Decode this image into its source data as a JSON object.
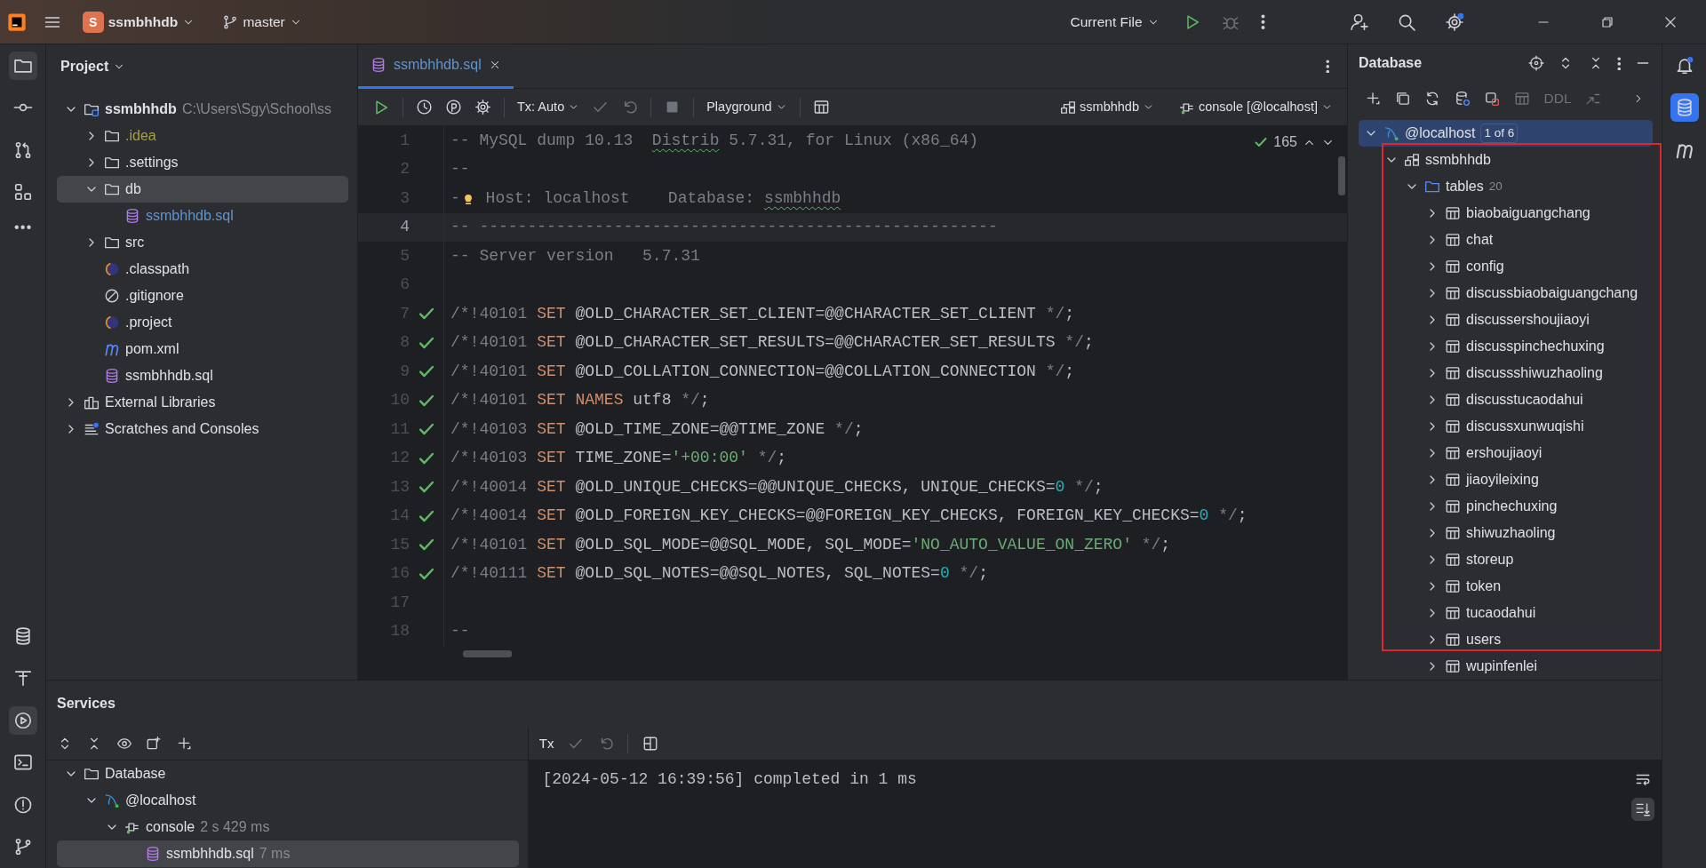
{
  "title_bar": {
    "project_badge": "S",
    "project": "ssmbhhdb",
    "branch": "master",
    "run_config": "Current File"
  },
  "left_toolbar": {
    "top": [
      {
        "kind": "folder",
        "selected": true
      },
      {
        "kind": "commit",
        "selected": false
      },
      {
        "kind": "pull_requests",
        "selected": false
      },
      {
        "kind": "structure",
        "selected": false
      },
      {
        "kind": "more",
        "selected": false
      }
    ],
    "bottom": [
      {
        "kind": "database",
        "selected": false
      },
      {
        "kind": "build",
        "selected": false
      },
      {
        "kind": "services",
        "selected": true
      },
      {
        "kind": "terminal",
        "selected": false
      },
      {
        "kind": "problems",
        "selected": false
      },
      {
        "kind": "git",
        "selected": false
      }
    ]
  },
  "right_toolbar": [
    {
      "kind": "notifications",
      "selected": false
    },
    {
      "kind": "database",
      "selected": true
    },
    {
      "kind": "maven",
      "selected": false
    }
  ],
  "project_panel": {
    "title": "Project",
    "tree": [
      {
        "label": "ssmbhhdb",
        "detail": "C:\\Users\\Sgy\\School\\ss",
        "kind": "module",
        "expanded": true,
        "selected": false,
        "children": [
          {
            "label": ".idea",
            "kind": "folder",
            "expanded": false,
            "selected": false,
            "color": "#a8a23a"
          },
          {
            "label": ".settings",
            "kind": "folder",
            "expanded": false,
            "selected": false
          },
          {
            "label": "db",
            "kind": "folder",
            "expanded": true,
            "selected": true,
            "children": [
              {
                "label": "ssmbhhdb.sql",
                "kind": "sql",
                "selected": false,
                "color": "#5e95d0"
              }
            ]
          },
          {
            "label": "src",
            "kind": "folder",
            "expanded": false,
            "selected": false
          },
          {
            "label": ".classpath",
            "kind": "eclipse",
            "selected": false
          },
          {
            "label": ".gitignore",
            "kind": "ignore",
            "selected": false
          },
          {
            "label": ".project",
            "kind": "eclipse",
            "selected": false
          },
          {
            "label": "pom.xml",
            "kind": "maven",
            "selected": false
          },
          {
            "label": "ssmbhhdb.sql",
            "kind": "sql",
            "selected": false
          }
        ]
      },
      {
        "label": "External Libraries",
        "kind": "libraries",
        "expanded": false,
        "selected": false
      },
      {
        "label": "Scratches and Consoles",
        "kind": "scratches",
        "expanded": false,
        "selected": false
      }
    ]
  },
  "editor": {
    "tab": {
      "label": "ssmbhhdb.sql",
      "selected": true
    },
    "toolbar": {
      "tx_mode": "Tx: Auto",
      "mode": "Playground",
      "schema": "ssmbhhdb",
      "session": "console [@localhost]"
    },
    "inspection_count": "165",
    "lines": [
      {
        "number": "1",
        "checked": false,
        "current": false,
        "tokens": [
          {
            "kind": "comment",
            "text": "-- MySQL dump 10.13  "
          },
          {
            "kind": "typo",
            "text": "Distrib"
          },
          {
            "kind": "comment",
            "text": " 5.7.31, for Linux (x86_64)"
          }
        ]
      },
      {
        "number": "2",
        "checked": false,
        "current": false,
        "tokens": [
          {
            "kind": "comment",
            "text": "--"
          }
        ]
      },
      {
        "number": "3",
        "checked": false,
        "current": false,
        "tokens": [
          {
            "kind": "comment",
            "text": "-"
          },
          {
            "kind": "bulb"
          },
          {
            "kind": "comment",
            "text": " Host: localhost    Database: "
          },
          {
            "kind": "typo",
            "text": "ssmbhhdb"
          }
        ]
      },
      {
        "number": "4",
        "checked": false,
        "current": true,
        "tokens": [
          {
            "kind": "comment",
            "text": "-- ------------------------------------------------------"
          }
        ]
      },
      {
        "number": "5",
        "checked": false,
        "current": false,
        "tokens": [
          {
            "kind": "comment",
            "text": "-- Server version   5.7.31"
          }
        ]
      },
      {
        "number": "6",
        "checked": false,
        "current": false
      },
      {
        "number": "7",
        "checked": true,
        "current": false,
        "tokens": [
          {
            "kind": "comment",
            "text": "/*!40101 "
          },
          {
            "kind": "keyword",
            "text": "SET"
          },
          {
            "kind": "plain",
            "text": " @OLD_CHARACTER_SET_CLIENT=@@CHARACTER_SET_CLIENT "
          },
          {
            "kind": "comment",
            "text": "*/"
          },
          {
            "kind": "plain",
            "text": ";"
          }
        ]
      },
      {
        "number": "8",
        "checked": true,
        "current": false,
        "tokens": [
          {
            "kind": "comment",
            "text": "/*!40101 "
          },
          {
            "kind": "keyword",
            "text": "SET"
          },
          {
            "kind": "plain",
            "text": " @OLD_CHARACTER_SET_RESULTS=@@CHARACTER_SET_RESULTS "
          },
          {
            "kind": "comment",
            "text": "*/"
          },
          {
            "kind": "plain",
            "text": ";"
          }
        ]
      },
      {
        "number": "9",
        "checked": true,
        "current": false,
        "tokens": [
          {
            "kind": "comment",
            "text": "/*!40101 "
          },
          {
            "kind": "keyword",
            "text": "SET"
          },
          {
            "kind": "plain",
            "text": " @OLD_COLLATION_CONNECTION=@@COLLATION_CONNECTION "
          },
          {
            "kind": "comment",
            "text": "*/"
          },
          {
            "kind": "plain",
            "text": ";"
          }
        ]
      },
      {
        "number": "10",
        "checked": true,
        "current": false,
        "tokens": [
          {
            "kind": "comment",
            "text": "/*!40101 "
          },
          {
            "kind": "keyword",
            "text": "SET NAMES"
          },
          {
            "kind": "plain",
            "text": " utf8 "
          },
          {
            "kind": "comment",
            "text": "*/"
          },
          {
            "kind": "plain",
            "text": ";"
          }
        ]
      },
      {
        "number": "11",
        "checked": true,
        "current": false,
        "tokens": [
          {
            "kind": "comment",
            "text": "/*!40103 "
          },
          {
            "kind": "keyword",
            "text": "SET"
          },
          {
            "kind": "plain",
            "text": " @OLD_TIME_ZONE=@@TIME_ZONE "
          },
          {
            "kind": "comment",
            "text": "*/"
          },
          {
            "kind": "plain",
            "text": ";"
          }
        ]
      },
      {
        "number": "12",
        "checked": true,
        "current": false,
        "tokens": [
          {
            "kind": "comment",
            "text": "/*!40103 "
          },
          {
            "kind": "keyword",
            "text": "SET"
          },
          {
            "kind": "plain",
            "text": " TIME_ZONE="
          },
          {
            "kind": "string",
            "text": "'+00:00'"
          },
          {
            "kind": "comment",
            "text": " */"
          },
          {
            "kind": "plain",
            "text": ";"
          }
        ]
      },
      {
        "number": "13",
        "checked": true,
        "current": false,
        "tokens": [
          {
            "kind": "comment",
            "text": "/*!40014 "
          },
          {
            "kind": "keyword",
            "text": "SET"
          },
          {
            "kind": "plain",
            "text": " @OLD_UNIQUE_CHECKS=@@UNIQUE_CHECKS, UNIQUE_CHECKS="
          },
          {
            "kind": "number",
            "text": "0"
          },
          {
            "kind": "comment",
            "text": " */"
          },
          {
            "kind": "plain",
            "text": ";"
          }
        ]
      },
      {
        "number": "14",
        "checked": true,
        "current": false,
        "tokens": [
          {
            "kind": "comment",
            "text": "/*!40014 "
          },
          {
            "kind": "keyword",
            "text": "SET"
          },
          {
            "kind": "plain",
            "text": " @OLD_FOREIGN_KEY_CHECKS=@@FOREIGN_KEY_CHECKS, FOREIGN_KEY_CHECKS="
          },
          {
            "kind": "number",
            "text": "0"
          },
          {
            "kind": "comment",
            "text": " */"
          },
          {
            "kind": "plain",
            "text": ";"
          }
        ]
      },
      {
        "number": "15",
        "checked": true,
        "current": false,
        "tokens": [
          {
            "kind": "comment",
            "text": "/*!40101 "
          },
          {
            "kind": "keyword",
            "text": "SET"
          },
          {
            "kind": "plain",
            "text": " @OLD_SQL_MODE=@@SQL_MODE, SQL_MODE="
          },
          {
            "kind": "string",
            "text": "'NO_AUTO_VALUE_ON_ZERO'"
          },
          {
            "kind": "comment",
            "text": " */"
          },
          {
            "kind": "plain",
            "text": ";"
          }
        ]
      },
      {
        "number": "16",
        "checked": true,
        "current": false,
        "tokens": [
          {
            "kind": "comment",
            "text": "/*!40111 "
          },
          {
            "kind": "keyword",
            "text": "SET"
          },
          {
            "kind": "plain",
            "text": " @OLD_SQL_NOTES=@@SQL_NOTES, SQL_NOTES="
          },
          {
            "kind": "number",
            "text": "0"
          },
          {
            "kind": "comment",
            "text": " */"
          },
          {
            "kind": "plain",
            "text": ";"
          }
        ]
      },
      {
        "number": "17",
        "checked": false,
        "current": false
      },
      {
        "number": "18",
        "checked": false,
        "current": false,
        "tokens": [
          {
            "kind": "comment",
            "text": "--"
          }
        ]
      }
    ]
  },
  "database_panel": {
    "title": "Database",
    "toolbar_label": "DDL",
    "tree": [
      {
        "label": "@localhost",
        "badge": "1 of 6",
        "kind": "mysql",
        "expanded": true,
        "selected": true,
        "children": [
          {
            "label": "ssmbhhdb",
            "kind": "schema",
            "expanded": true,
            "selected": false,
            "children": [
              {
                "label": "tables",
                "count": "20",
                "kind": "folder_blue",
                "expanded": true,
                "selected": false,
                "children": [
                  {
                    "label": "biaobaiguangchang",
                    "kind": "table",
                    "expanded": false,
                    "selected": false
                  },
                  {
                    "label": "chat",
                    "kind": "table",
                    "expanded": false,
                    "selected": false
                  },
                  {
                    "label": "config",
                    "kind": "table",
                    "expanded": false,
                    "selected": false
                  },
                  {
                    "label": "discussbiaobaiguangchang",
                    "kind": "table",
                    "expanded": false,
                    "selected": false
                  },
                  {
                    "label": "discussershoujiaoyi",
                    "kind": "table",
                    "expanded": false,
                    "selected": false
                  },
                  {
                    "label": "discusspinchechuxing",
                    "kind": "table",
                    "expanded": false,
                    "selected": false
                  },
                  {
                    "label": "discussshiwuzhaoling",
                    "kind": "table",
                    "expanded": false,
                    "selected": false
                  },
                  {
                    "label": "discusstucaodahui",
                    "kind": "table",
                    "expanded": false,
                    "selected": false
                  },
                  {
                    "label": "discussxunwuqishi",
                    "kind": "table",
                    "expanded": false,
                    "selected": false
                  },
                  {
                    "label": "ershoujiaoyi",
                    "kind": "table",
                    "expanded": false,
                    "selected": false
                  },
                  {
                    "label": "jiaoyileixing",
                    "kind": "table",
                    "expanded": false,
                    "selected": false
                  },
                  {
                    "label": "pinchechuxing",
                    "kind": "table",
                    "expanded": false,
                    "selected": false
                  },
                  {
                    "label": "shiwuzhaoling",
                    "kind": "table",
                    "expanded": false,
                    "selected": false
                  },
                  {
                    "label": "storeup",
                    "kind": "table",
                    "expanded": false,
                    "selected": false
                  },
                  {
                    "label": "token",
                    "kind": "table",
                    "expanded": false,
                    "selected": false
                  },
                  {
                    "label": "tucaodahui",
                    "kind": "table",
                    "expanded": false,
                    "selected": false
                  },
                  {
                    "label": "users",
                    "kind": "table",
                    "expanded": false,
                    "selected": false
                  },
                  {
                    "label": "wupinfenlei",
                    "kind": "table",
                    "expanded": false,
                    "selected": false
                  }
                ]
              }
            ]
          }
        ]
      }
    ]
  },
  "services": {
    "title": "Services",
    "tree": [
      {
        "label": "Database",
        "kind": "folder",
        "expanded": true,
        "selected": false,
        "children": [
          {
            "label": "@localhost",
            "kind": "mysql",
            "expanded": true,
            "selected": false,
            "children": [
              {
                "label": "console",
                "detail": "2 s 429 ms",
                "kind": "console",
                "expanded": true,
                "selected": false,
                "children": [
                  {
                    "label": "ssmbhhdb.sql",
                    "detail": "7 ms",
                    "kind": "sql",
                    "selected": true
                  }
                ]
              }
            ]
          }
        ]
      }
    ],
    "output_toolbar_label": "Tx",
    "output": [
      "[2024-05-12 16:39:56] completed in 1 ms"
    ]
  }
}
